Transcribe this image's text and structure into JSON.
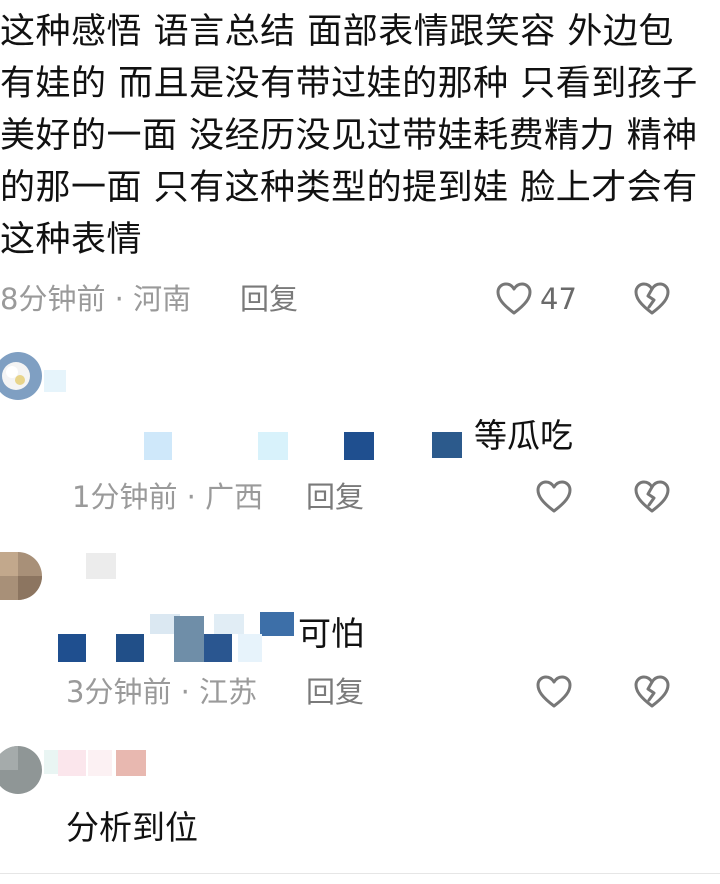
{
  "top_comment": {
    "text": "这种感悟  语言总结  面部表情跟笑容  外边包有娃的  而且是没有带过娃的那种  只看到孩子美好的一面  没经历没见过带娃耗费精力  精神的那一面  只有这种类型的提到娃  脸上才会有这种表情",
    "meta": "8分钟前 · 河南",
    "reply_label": "回复",
    "like_count": "47"
  },
  "replies": [
    {
      "text": "等瓜吃",
      "meta": "1分钟前 · 广西",
      "reply_label": "回复"
    },
    {
      "text": "可怕",
      "meta": "3分钟前 · 江苏",
      "reply_label": "回复"
    },
    {
      "text": "分析到位"
    }
  ],
  "icons": {
    "like": "heart-outline-icon",
    "dislike": "broken-heart-icon"
  },
  "colors": {
    "text": "#111111",
    "meta": "#9a9a9a",
    "icon": "#777777",
    "mosaic_blue": "#1f4f8f"
  }
}
